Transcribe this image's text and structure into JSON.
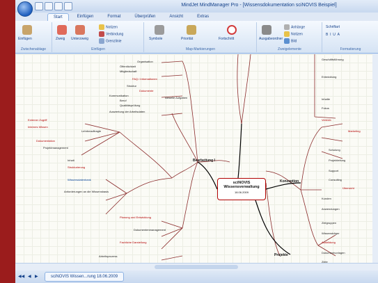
{
  "window": {
    "title": "MindJet MindManager Pro - [Wissensdokumentation sciNOVIS Beispiel]"
  },
  "ribbon": {
    "tabs": [
      "Start",
      "Einfügen",
      "Format",
      "Überprüfen",
      "Ansicht",
      "Extras"
    ],
    "active_tab": "Start",
    "groups": [
      {
        "label": "Zwischenablage",
        "buttons": [
          "Einfügen"
        ]
      },
      {
        "label": "Einfügen",
        "buttons": [
          "Zweig",
          "Unterzweig",
          "Notizen",
          "Verbindung",
          "Grenzlinie"
        ]
      },
      {
        "label": "Map-Markierungen",
        "buttons": [
          "Symbole",
          "Priorität",
          "Fortschritt"
        ]
      },
      {
        "label": "Zweigelemente",
        "buttons": [
          "Ausgabeordner",
          "Anhänge",
          "Notizen",
          "Bild"
        ]
      },
      {
        "label": "Formatierung",
        "buttons": [
          "Schriftart"
        ]
      }
    ]
  },
  "map": {
    "center_title": "sciNOVIS Wissensverwaltung",
    "center_date": "18.06.2009",
    "branches": [
      "Bearbeitung I",
      "Konzeption",
      "Projekte"
    ],
    "left_topics": [
      "Organisation",
      "Öffentlichkeit",
      "Mitgliedschaft",
      "FAQ / Informationen",
      "Struktur",
      "Dokumente",
      "Aktuelle Aufgaben",
      "Kommunikation",
      "Beruf",
      "Qualitätsprüfung",
      "Auswertung der Arbeitsdaten",
      "Externer Zugriff",
      "Internes Wissen",
      "Lehrbeauftragte",
      "Dokumentation",
      "Projektmanagement",
      "Inhalt",
      "Strukturierung",
      "Wissensdatenbank",
      "Anforderungen an die Wissensbasis",
      "Planung und Entwicklung",
      "Dokumentenmanagement",
      "Fachliche Darstellung",
      "Arbeitsprozess"
    ],
    "right_topics": [
      "Geschäftsführung",
      "Entwicklung",
      "Inhalte",
      "Fokus",
      "Vertrieb",
      "Marketing",
      "Schulung",
      "Projektleitung",
      "Support",
      "Consulting",
      "Übersicht",
      "Kunden",
      "Anwendungen",
      "Zielgruppen",
      "Wissensträger",
      "Ausbildung",
      "Dokumentvorlagen",
      "Ziele"
    ]
  },
  "status": {
    "doc_tab": "sciNOVIS Wissen...rung 18.06.2009"
  },
  "colors": {
    "frame": "#9b1c1c",
    "ribbon": "#dfe8f5",
    "accent": "#b00000",
    "link": "#003f99"
  }
}
